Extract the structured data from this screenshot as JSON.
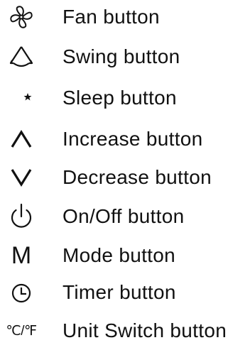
{
  "legend": {
    "items": [
      {
        "icon": "fan-icon",
        "label": "Fan button"
      },
      {
        "icon": "swing-icon",
        "label": "Swing button"
      },
      {
        "icon": "sleep-icon",
        "label": "Sleep button"
      },
      {
        "icon": "increase-icon",
        "label": "Increase button"
      },
      {
        "icon": "decrease-icon",
        "label": "Decrease button"
      },
      {
        "icon": "power-icon",
        "label": "On/Off button"
      },
      {
        "icon": "mode-icon",
        "label": "Mode button",
        "icon_text": "M"
      },
      {
        "icon": "timer-icon",
        "label": "Timer button"
      },
      {
        "icon": "unit-switch-icon",
        "label": "Unit Switch button",
        "icon_text": "℃/℉"
      }
    ]
  }
}
